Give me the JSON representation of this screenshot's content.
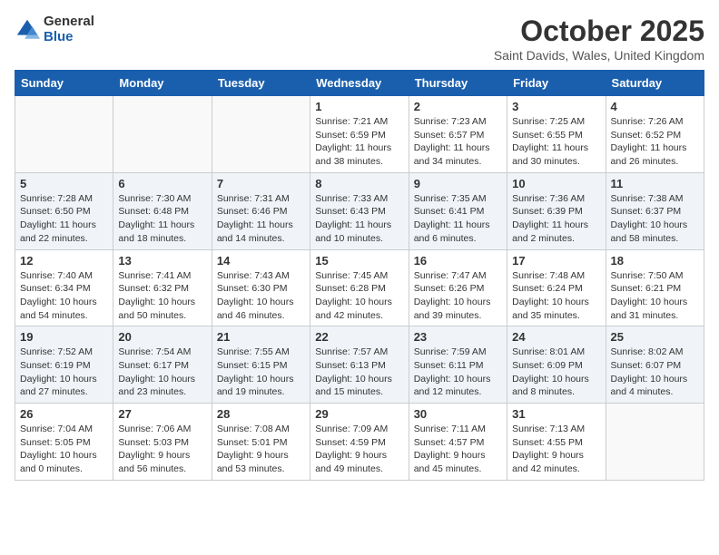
{
  "header": {
    "logo_general": "General",
    "logo_blue": "Blue",
    "month_title": "October 2025",
    "location": "Saint Davids, Wales, United Kingdom"
  },
  "days_of_week": [
    "Sunday",
    "Monday",
    "Tuesday",
    "Wednesday",
    "Thursday",
    "Friday",
    "Saturday"
  ],
  "weeks": [
    [
      {
        "day": "",
        "text": ""
      },
      {
        "day": "",
        "text": ""
      },
      {
        "day": "",
        "text": ""
      },
      {
        "day": "1",
        "text": "Sunrise: 7:21 AM\nSunset: 6:59 PM\nDaylight: 11 hours\nand 38 minutes."
      },
      {
        "day": "2",
        "text": "Sunrise: 7:23 AM\nSunset: 6:57 PM\nDaylight: 11 hours\nand 34 minutes."
      },
      {
        "day": "3",
        "text": "Sunrise: 7:25 AM\nSunset: 6:55 PM\nDaylight: 11 hours\nand 30 minutes."
      },
      {
        "day": "4",
        "text": "Sunrise: 7:26 AM\nSunset: 6:52 PM\nDaylight: 11 hours\nand 26 minutes."
      }
    ],
    [
      {
        "day": "5",
        "text": "Sunrise: 7:28 AM\nSunset: 6:50 PM\nDaylight: 11 hours\nand 22 minutes."
      },
      {
        "day": "6",
        "text": "Sunrise: 7:30 AM\nSunset: 6:48 PM\nDaylight: 11 hours\nand 18 minutes."
      },
      {
        "day": "7",
        "text": "Sunrise: 7:31 AM\nSunset: 6:46 PM\nDaylight: 11 hours\nand 14 minutes."
      },
      {
        "day": "8",
        "text": "Sunrise: 7:33 AM\nSunset: 6:43 PM\nDaylight: 11 hours\nand 10 minutes."
      },
      {
        "day": "9",
        "text": "Sunrise: 7:35 AM\nSunset: 6:41 PM\nDaylight: 11 hours\nand 6 minutes."
      },
      {
        "day": "10",
        "text": "Sunrise: 7:36 AM\nSunset: 6:39 PM\nDaylight: 11 hours\nand 2 minutes."
      },
      {
        "day": "11",
        "text": "Sunrise: 7:38 AM\nSunset: 6:37 PM\nDaylight: 10 hours\nand 58 minutes."
      }
    ],
    [
      {
        "day": "12",
        "text": "Sunrise: 7:40 AM\nSunset: 6:34 PM\nDaylight: 10 hours\nand 54 minutes."
      },
      {
        "day": "13",
        "text": "Sunrise: 7:41 AM\nSunset: 6:32 PM\nDaylight: 10 hours\nand 50 minutes."
      },
      {
        "day": "14",
        "text": "Sunrise: 7:43 AM\nSunset: 6:30 PM\nDaylight: 10 hours\nand 46 minutes."
      },
      {
        "day": "15",
        "text": "Sunrise: 7:45 AM\nSunset: 6:28 PM\nDaylight: 10 hours\nand 42 minutes."
      },
      {
        "day": "16",
        "text": "Sunrise: 7:47 AM\nSunset: 6:26 PM\nDaylight: 10 hours\nand 39 minutes."
      },
      {
        "day": "17",
        "text": "Sunrise: 7:48 AM\nSunset: 6:24 PM\nDaylight: 10 hours\nand 35 minutes."
      },
      {
        "day": "18",
        "text": "Sunrise: 7:50 AM\nSunset: 6:21 PM\nDaylight: 10 hours\nand 31 minutes."
      }
    ],
    [
      {
        "day": "19",
        "text": "Sunrise: 7:52 AM\nSunset: 6:19 PM\nDaylight: 10 hours\nand 27 minutes."
      },
      {
        "day": "20",
        "text": "Sunrise: 7:54 AM\nSunset: 6:17 PM\nDaylight: 10 hours\nand 23 minutes."
      },
      {
        "day": "21",
        "text": "Sunrise: 7:55 AM\nSunset: 6:15 PM\nDaylight: 10 hours\nand 19 minutes."
      },
      {
        "day": "22",
        "text": "Sunrise: 7:57 AM\nSunset: 6:13 PM\nDaylight: 10 hours\nand 15 minutes."
      },
      {
        "day": "23",
        "text": "Sunrise: 7:59 AM\nSunset: 6:11 PM\nDaylight: 10 hours\nand 12 minutes."
      },
      {
        "day": "24",
        "text": "Sunrise: 8:01 AM\nSunset: 6:09 PM\nDaylight: 10 hours\nand 8 minutes."
      },
      {
        "day": "25",
        "text": "Sunrise: 8:02 AM\nSunset: 6:07 PM\nDaylight: 10 hours\nand 4 minutes."
      }
    ],
    [
      {
        "day": "26",
        "text": "Sunrise: 7:04 AM\nSunset: 5:05 PM\nDaylight: 10 hours\nand 0 minutes."
      },
      {
        "day": "27",
        "text": "Sunrise: 7:06 AM\nSunset: 5:03 PM\nDaylight: 9 hours\nand 56 minutes."
      },
      {
        "day": "28",
        "text": "Sunrise: 7:08 AM\nSunset: 5:01 PM\nDaylight: 9 hours\nand 53 minutes."
      },
      {
        "day": "29",
        "text": "Sunrise: 7:09 AM\nSunset: 4:59 PM\nDaylight: 9 hours\nand 49 minutes."
      },
      {
        "day": "30",
        "text": "Sunrise: 7:11 AM\nSunset: 4:57 PM\nDaylight: 9 hours\nand 45 minutes."
      },
      {
        "day": "31",
        "text": "Sunrise: 7:13 AM\nSunset: 4:55 PM\nDaylight: 9 hours\nand 42 minutes."
      },
      {
        "day": "",
        "text": ""
      }
    ]
  ]
}
